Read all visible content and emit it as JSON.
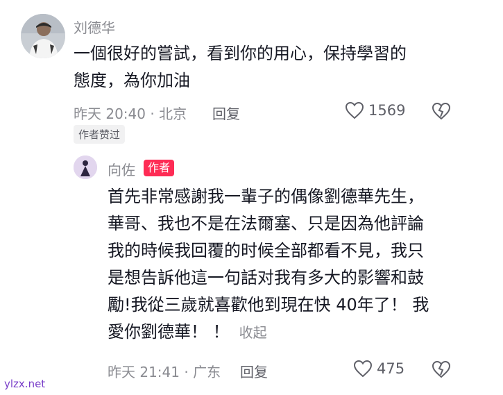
{
  "comment1": {
    "username": "刘德华",
    "line1": "一個很好的嘗試，看到你的用心，保持學習的",
    "line2": "態度，為你加油",
    "time_location": "昨天 20:40 · 北京",
    "reply_label": "回复",
    "like_count": "1569",
    "chip": "作者赞过"
  },
  "comment2": {
    "username": "向佐",
    "badge": "作者",
    "lines": [
      "首先非常感謝我一輩子的偶像劉德華先生，",
      "華哥、我也不是在法爾塞、只是因為他評論",
      "我的時候我回覆的时候全部都看不見，我只",
      "是想告訴他這一句話对我有多大的影響和鼓",
      "勵!我從三歲就喜歡他到現在快 40年了！ 我",
      "愛你劉德華！ ！"
    ],
    "collapse_label": "收起",
    "time_location": "昨天 21:41 · 广东",
    "reply_label": "回复",
    "like_count": "475"
  },
  "watermark": "ylzx.net",
  "colors": {
    "badge": "#fe2c55",
    "secondary_text": "#8a8b91",
    "watermark": "#7a3fc9"
  }
}
